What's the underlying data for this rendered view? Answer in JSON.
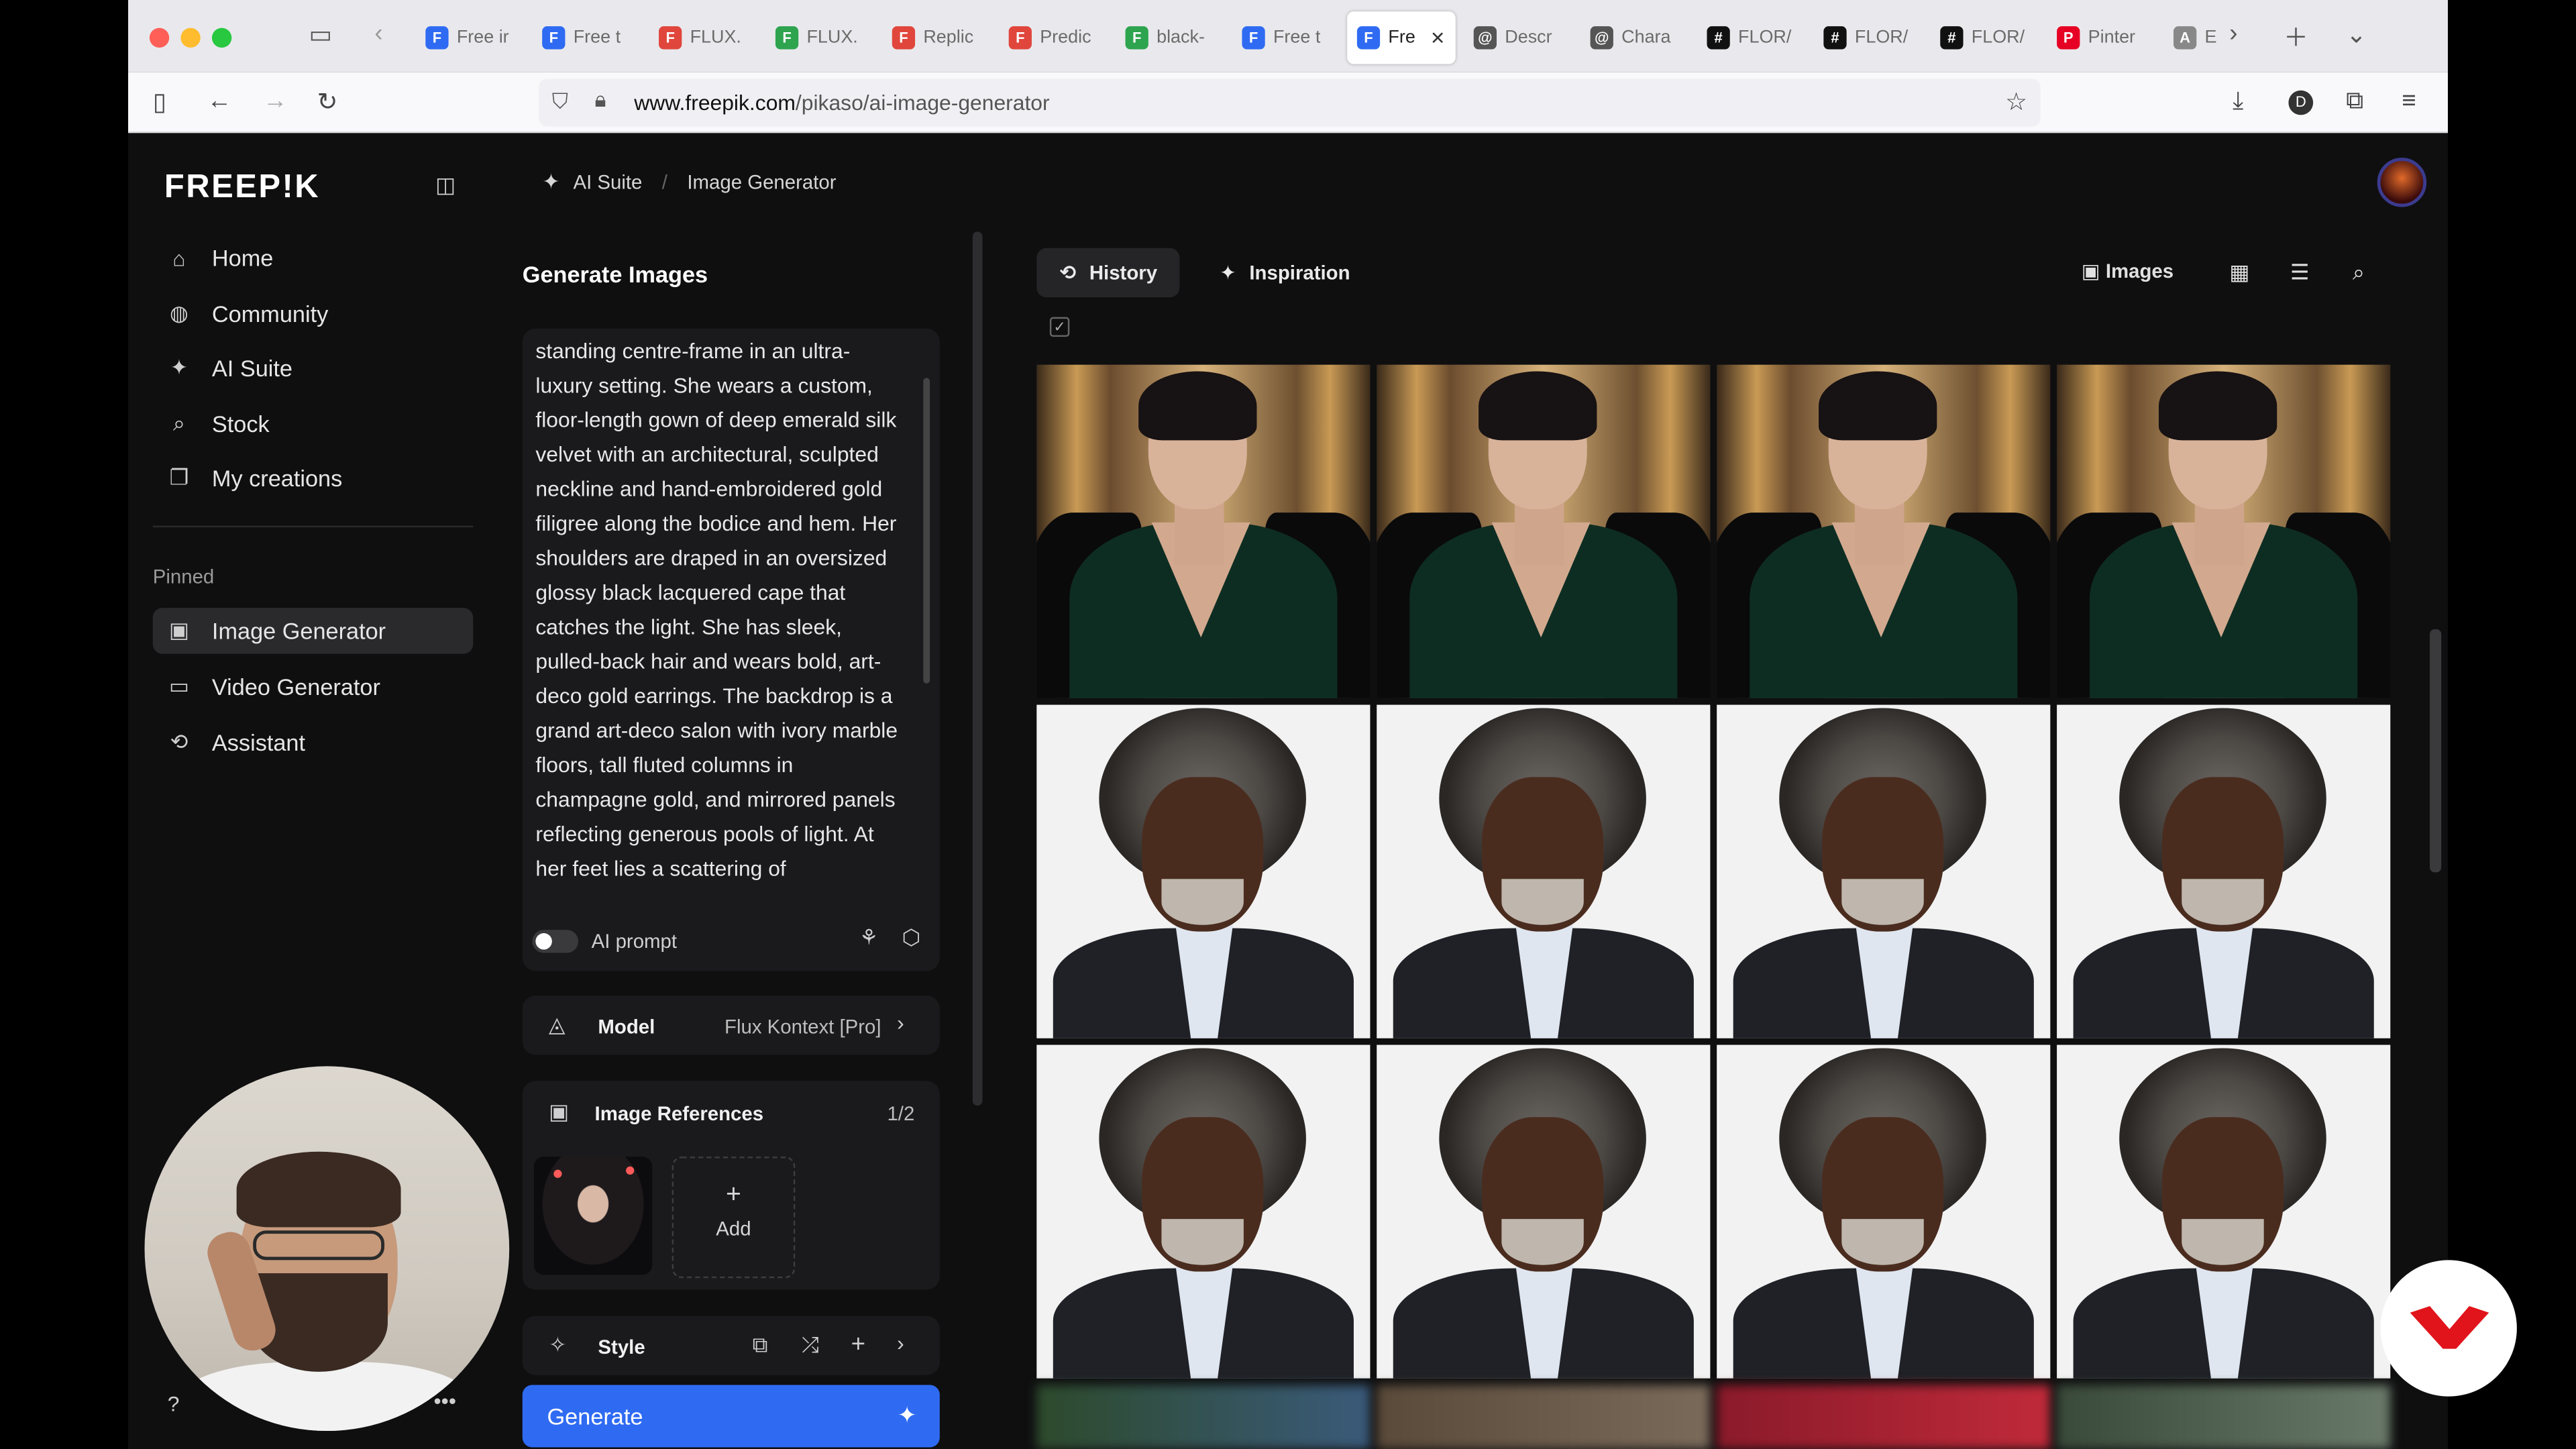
{
  "browser": {
    "tabs": [
      {
        "title": "Free ir",
        "icon": "F",
        "color": "#2f6bf2"
      },
      {
        "title": "Free t",
        "icon": "F",
        "color": "#2f6bf2"
      },
      {
        "title": "FLUX.",
        "icon": "F",
        "color": "#e0463c"
      },
      {
        "title": "FLUX.",
        "icon": "F",
        "color": "#2ea44f"
      },
      {
        "title": "Replic",
        "icon": "F",
        "color": "#e0463c"
      },
      {
        "title": "Predic",
        "icon": "F",
        "color": "#e0463c"
      },
      {
        "title": "black-",
        "icon": "F",
        "color": "#2ea44f"
      },
      {
        "title": "Free t",
        "icon": "F",
        "color": "#2f6bf2"
      },
      {
        "title": "Fre",
        "icon": "F",
        "color": "#2f6bf2",
        "active": true
      },
      {
        "title": "Descr",
        "icon": "@",
        "color": "#555"
      },
      {
        "title": "Chara",
        "icon": "@",
        "color": "#555"
      },
      {
        "title": "FLOR/",
        "icon": "#",
        "color": "#111"
      },
      {
        "title": "FLOR/",
        "icon": "#",
        "color": "#111"
      },
      {
        "title": "FLOR/",
        "icon": "#",
        "color": "#111"
      },
      {
        "title": "Pinter",
        "icon": "P",
        "color": "#e60023"
      },
      {
        "title": "E",
        "icon": "A",
        "color": "#888"
      }
    ],
    "url_domain": "www.freepik.com",
    "url_path": "/pikaso/ai-image-generator"
  },
  "sidebar": {
    "logo": "FREEP!K",
    "items": [
      {
        "label": "Home",
        "icon": "home-icon"
      },
      {
        "label": "Community",
        "icon": "globe-icon"
      },
      {
        "label": "AI Suite",
        "icon": "sparkles-icon"
      },
      {
        "label": "Stock",
        "icon": "search-icon"
      },
      {
        "label": "My creations",
        "icon": "stack-icon"
      }
    ],
    "pinned_label": "Pinned",
    "pinned": [
      {
        "label": "Image Generator",
        "icon": "image-icon",
        "selected": true
      },
      {
        "label": "Video Generator",
        "icon": "video-icon"
      },
      {
        "label": "Assistant",
        "icon": "chat-icon"
      }
    ]
  },
  "breadcrumb": {
    "root": "AI Suite",
    "current": "Image Generator"
  },
  "generator": {
    "title": "Generate Images",
    "prompt": "standing centre-frame in an ultra-luxury setting. She wears a custom, floor-length gown of deep emerald silk velvet with an architectural, sculpted neckline and hand-embroidered gold filigree along the bodice and hem. Her shoulders are draped in an oversized glossy black lacquered cape that catches the light. She has sleek, pulled-back hair and wears bold, art-deco gold earrings. The backdrop is a grand art-deco salon with ivory marble floors, tall fluted columns in champagne gold, and mirrored panels reflecting generous pools of light. At her feet lies a scattering of",
    "ai_prompt_label": "AI prompt",
    "ai_prompt_enabled": false,
    "model_label": "Model",
    "model_value": "Flux Kontext [Pro]",
    "references_label": "Image References",
    "references_count": "1/2",
    "add_label": "Add",
    "style_label": "Style",
    "generate_label": "Generate"
  },
  "results": {
    "tabs": [
      {
        "label": "History",
        "selected": true
      },
      {
        "label": "Inspiration",
        "selected": false
      }
    ],
    "images_label": "Images",
    "rows": [
      [
        "woman",
        "woman",
        "woman",
        "woman"
      ],
      [
        "man",
        "man",
        "man",
        "man"
      ],
      [
        "man",
        "man",
        "man",
        "man"
      ]
    ]
  },
  "colors": {
    "accent": "#2f6bf2",
    "bg": "#0f0f10",
    "card": "#1a1a1c",
    "badge": "#e1141b"
  }
}
